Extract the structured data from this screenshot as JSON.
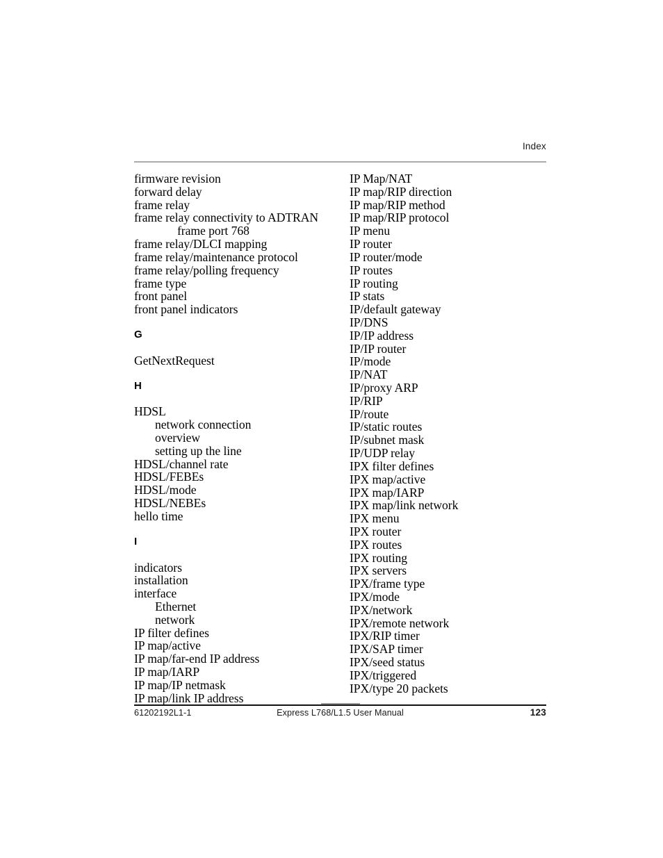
{
  "header": {
    "running_head": "Index"
  },
  "index": {
    "left_column": [
      {
        "type": "entry",
        "level": 1,
        "text": "firmware revision"
      },
      {
        "type": "entry",
        "level": 1,
        "text": "forward delay"
      },
      {
        "type": "entry",
        "level": 1,
        "text": "frame relay"
      },
      {
        "type": "entry",
        "level": 1,
        "text": "frame relay connectivity to ADTRAN"
      },
      {
        "type": "entry",
        "level": 3,
        "text": "frame port 768"
      },
      {
        "type": "entry",
        "level": 1,
        "text": "frame relay/DLCI mapping"
      },
      {
        "type": "entry",
        "level": 1,
        "text": "frame relay/maintenance protocol"
      },
      {
        "type": "entry",
        "level": 1,
        "text": "frame relay/polling frequency"
      },
      {
        "type": "entry",
        "level": 1,
        "text": "frame type"
      },
      {
        "type": "entry",
        "level": 1,
        "text": "front panel"
      },
      {
        "type": "entry",
        "level": 1,
        "text": "front panel indicators"
      },
      {
        "type": "letter",
        "text": "G"
      },
      {
        "type": "entry",
        "level": 1,
        "text": "GetNextRequest"
      },
      {
        "type": "letter",
        "text": "H"
      },
      {
        "type": "entry",
        "level": 1,
        "text": "HDSL"
      },
      {
        "type": "entry",
        "level": 2,
        "text": "network connection"
      },
      {
        "type": "entry",
        "level": 2,
        "text": "overview"
      },
      {
        "type": "entry",
        "level": 2,
        "text": "setting up the line"
      },
      {
        "type": "entry",
        "level": 1,
        "text": "HDSL/channel rate"
      },
      {
        "type": "entry",
        "level": 1,
        "text": "HDSL/FEBEs"
      },
      {
        "type": "entry",
        "level": 1,
        "text": "HDSL/mode"
      },
      {
        "type": "entry",
        "level": 1,
        "text": "HDSL/NEBEs"
      },
      {
        "type": "entry",
        "level": 1,
        "text": "hello time"
      },
      {
        "type": "letter",
        "text": "I"
      },
      {
        "type": "entry",
        "level": 1,
        "text": "indicators"
      },
      {
        "type": "entry",
        "level": 1,
        "text": "installation"
      },
      {
        "type": "entry",
        "level": 1,
        "text": "interface"
      },
      {
        "type": "entry",
        "level": 2,
        "text": "Ethernet"
      },
      {
        "type": "entry",
        "level": 2,
        "text": "network"
      },
      {
        "type": "entry",
        "level": 1,
        "text": "IP filter defines"
      },
      {
        "type": "entry",
        "level": 1,
        "text": "IP map/active"
      },
      {
        "type": "entry",
        "level": 1,
        "text": "IP map/far-end IP address"
      },
      {
        "type": "entry",
        "level": 1,
        "text": "IP map/IARP"
      },
      {
        "type": "entry",
        "level": 1,
        "text": "IP map/IP netmask"
      },
      {
        "type": "entry",
        "level": 1,
        "text": "IP map/link IP address"
      }
    ],
    "right_column": [
      {
        "type": "entry",
        "level": 1,
        "text": "IP Map/NAT"
      },
      {
        "type": "entry",
        "level": 1,
        "text": "IP map/RIP direction"
      },
      {
        "type": "entry",
        "level": 1,
        "text": "IP map/RIP method"
      },
      {
        "type": "entry",
        "level": 1,
        "text": "IP map/RIP protocol"
      },
      {
        "type": "entry",
        "level": 1,
        "text": "IP menu"
      },
      {
        "type": "entry",
        "level": 1,
        "text": "IP router"
      },
      {
        "type": "entry",
        "level": 1,
        "text": "IP router/mode"
      },
      {
        "type": "entry",
        "level": 1,
        "text": "IP routes"
      },
      {
        "type": "entry",
        "level": 1,
        "text": "IP routing"
      },
      {
        "type": "entry",
        "level": 1,
        "text": "IP stats"
      },
      {
        "type": "entry",
        "level": 1,
        "text": "IP/default gateway"
      },
      {
        "type": "entry",
        "level": 1,
        "text": "IP/DNS"
      },
      {
        "type": "entry",
        "level": 1,
        "text": "IP/IP address"
      },
      {
        "type": "entry",
        "level": 1,
        "text": "IP/IP router"
      },
      {
        "type": "entry",
        "level": 1,
        "text": "IP/mode"
      },
      {
        "type": "entry",
        "level": 1,
        "text": "IP/NAT"
      },
      {
        "type": "entry",
        "level": 1,
        "text": "IP/proxy ARP"
      },
      {
        "type": "entry",
        "level": 1,
        "text": "IP/RIP"
      },
      {
        "type": "entry",
        "level": 1,
        "text": "IP/route"
      },
      {
        "type": "entry",
        "level": 1,
        "text": "IP/static routes"
      },
      {
        "type": "entry",
        "level": 1,
        "text": "IP/subnet mask"
      },
      {
        "type": "entry",
        "level": 1,
        "text": "IP/UDP relay"
      },
      {
        "type": "entry",
        "level": 1,
        "text": "IPX filter defines"
      },
      {
        "type": "entry",
        "level": 1,
        "text": "IPX map/active"
      },
      {
        "type": "entry",
        "level": 1,
        "text": "IPX map/IARP"
      },
      {
        "type": "entry",
        "level": 1,
        "text": "IPX map/link network"
      },
      {
        "type": "entry",
        "level": 1,
        "text": "IPX menu"
      },
      {
        "type": "entry",
        "level": 1,
        "text": "IPX router"
      },
      {
        "type": "entry",
        "level": 1,
        "text": "IPX routes"
      },
      {
        "type": "entry",
        "level": 1,
        "text": "IPX routing"
      },
      {
        "type": "entry",
        "level": 1,
        "text": "IPX servers"
      },
      {
        "type": "entry",
        "level": 1,
        "text": "IPX/frame type"
      },
      {
        "type": "entry",
        "level": 1,
        "text": "IPX/mode"
      },
      {
        "type": "entry",
        "level": 1,
        "text": "IPX/network"
      },
      {
        "type": "entry",
        "level": 1,
        "text": "IPX/remote network"
      },
      {
        "type": "entry",
        "level": 1,
        "text": "IPX/RIP timer"
      },
      {
        "type": "entry",
        "level": 1,
        "text": "IPX/SAP timer"
      },
      {
        "type": "entry",
        "level": 1,
        "text": "IPX/seed status"
      },
      {
        "type": "entry",
        "level": 1,
        "text": "IPX/triggered"
      },
      {
        "type": "entry",
        "level": 1,
        "text": "IPX/type 20 packets"
      }
    ]
  },
  "footer": {
    "document_number": "61202192L1-1",
    "manual_title": "Express L768/L1.5 User Manual",
    "page_number": "123"
  }
}
